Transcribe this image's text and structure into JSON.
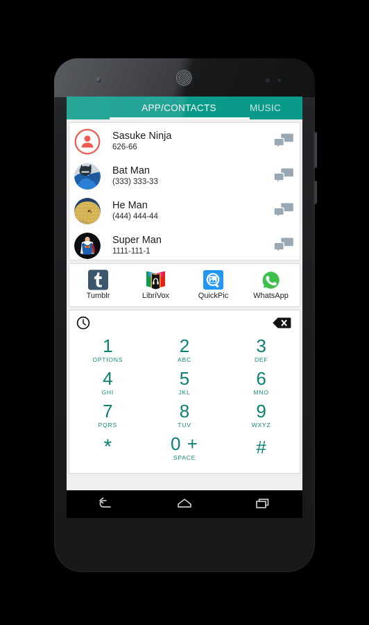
{
  "device": {
    "frame": "android-phone",
    "hardware": [
      "front-camera",
      "earpiece-speaker",
      "proximity-sensor"
    ]
  },
  "screen": {
    "tabs": {
      "previous_label": "",
      "active_label": "APP/CONTACTS",
      "next_label": "MUSIC",
      "accent_color": "#0a9a8a",
      "indicator_color": "#ffffff"
    },
    "contacts": [
      {
        "name": "Sasuke Ninja",
        "number": "626-66",
        "avatar": "default-person-avatar",
        "action": "message-icon"
      },
      {
        "name": "Bat Man",
        "number": "(333) 333-33",
        "avatar": "batman-photo-avatar",
        "action": "message-icon"
      },
      {
        "name": "He Man",
        "number": "(444) 444-44",
        "avatar": "heman-photo-avatar",
        "action": "message-icon"
      },
      {
        "name": "Super Man",
        "number": "1111-111-1",
        "avatar": "superman-photo-avatar",
        "action": "message-icon"
      }
    ],
    "apps": [
      {
        "label": "Tumblr",
        "icon": "tumblr-icon"
      },
      {
        "label": "LibriVox",
        "icon": "librivox-icon"
      },
      {
        "label": "QuickPic",
        "icon": "quickpic-icon"
      },
      {
        "label": "WhatsApp",
        "icon": "whatsapp-icon"
      }
    ],
    "dialpad": {
      "history_icon": "clock-icon",
      "backspace_icon": "backspace-icon",
      "digit_color": "#0d8074",
      "keys": [
        {
          "digit": "1",
          "sub": "OPTIONS"
        },
        {
          "digit": "2",
          "sub": "ABC"
        },
        {
          "digit": "3",
          "sub": "DEF"
        },
        {
          "digit": "4",
          "sub": "GHI"
        },
        {
          "digit": "5",
          "sub": "JKL"
        },
        {
          "digit": "6",
          "sub": "MNO"
        },
        {
          "digit": "7",
          "sub": "PQRS"
        },
        {
          "digit": "8",
          "sub": "TUV"
        },
        {
          "digit": "9",
          "sub": "WXYZ"
        },
        {
          "digit": "*",
          "sub": ""
        },
        {
          "digit": "0 +",
          "sub": "SPACE"
        },
        {
          "digit": "#",
          "sub": ""
        }
      ]
    }
  },
  "navbar": {
    "buttons": [
      {
        "name": "back-button",
        "icon": "back-arrow-icon"
      },
      {
        "name": "home-button",
        "icon": "home-icon"
      },
      {
        "name": "recents-button",
        "icon": "recents-icon"
      }
    ]
  }
}
